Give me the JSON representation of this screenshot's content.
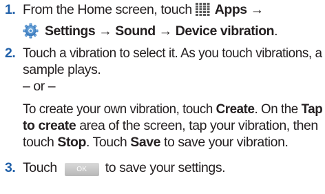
{
  "step1": {
    "number": "1.",
    "line1_a": "From the Home screen, touch",
    "apps": "Apps",
    "arrow": "→",
    "settings": "Settings",
    "sound": "Sound",
    "device_vibration": "Device vibration",
    "period": "."
  },
  "step2": {
    "number": "2.",
    "line1": "Touch a vibration to select it. As you touch vibrations, a",
    "line2": "sample plays.",
    "or": "– or –",
    "sub1_a": "To create your own vibration, touch",
    "create": "Create",
    "sub1_b": ". On the",
    "tap": "Tap",
    "to_create": "to create",
    "sub2_b": " area of the screen, tap your vibration, then",
    "sub3_a": "touch",
    "stop": "Stop",
    "sub3_b": ". Touch",
    "save": "Save",
    "sub3_c": " to save your vibration."
  },
  "step3": {
    "number": "3.",
    "touch": "Touch",
    "ok_label": "OK",
    "rest": "to save your settings."
  },
  "icons": {
    "apps": "apps-grid-icon",
    "settings": "settings-gear-icon"
  },
  "colors": {
    "text": "#231f20",
    "step_number": "#1f5fa8",
    "ok_button": "#c4c4c4"
  }
}
